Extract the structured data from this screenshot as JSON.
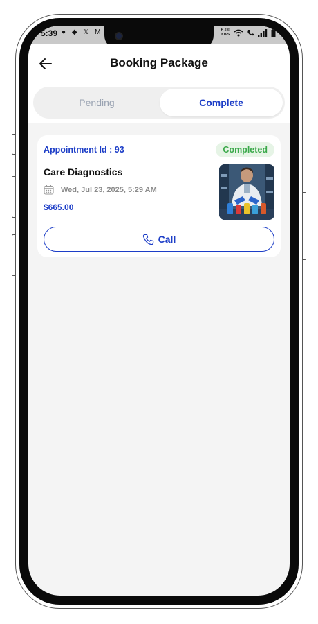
{
  "status_bar": {
    "time": "5:39",
    "left_icons": "● ◆ 𝕏 M M",
    "net_speed_value": "6.00",
    "net_speed_unit": "KB/S"
  },
  "header": {
    "title": "Booking Package",
    "back_icon": "arrow-left-icon"
  },
  "tabs": [
    {
      "label": "Pending",
      "active": false
    },
    {
      "label": "Complete",
      "active": true
    }
  ],
  "booking": {
    "appointment_id_label": "Appointment Id : 93",
    "status": "Completed",
    "provider": "Care Diagnostics",
    "datetime": "Wed, Jul 23, 2025, 5:29 AM",
    "price": "$665.00",
    "call_label": "Call",
    "thumbnail": "lab-scientist-photo"
  },
  "colors": {
    "accent": "#1d3ec7",
    "status_green": "#3aa94a",
    "status_green_bg": "#e6f4e6",
    "background": "#f4f4f4"
  }
}
